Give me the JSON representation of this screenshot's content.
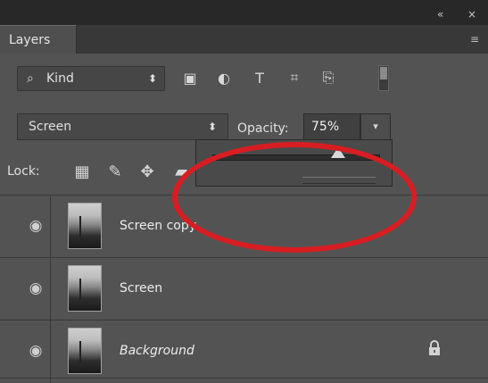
{
  "window": {
    "collapse_label": "«",
    "close_label": "×"
  },
  "panel": {
    "tab_label": "Layers",
    "menu_label": "≡"
  },
  "filter": {
    "kind_label": "Kind",
    "search_icon": "search-icon",
    "selector_arrows": "⬍",
    "icons": [
      "image-filter-icon",
      "adjustment-filter-icon",
      "type-filter-icon",
      "shape-filter-icon",
      "smart-object-filter-icon"
    ]
  },
  "blend": {
    "mode_label": "Screen",
    "arrows": "⬍"
  },
  "opacity": {
    "label": "Opacity:",
    "value": "75%",
    "slider_fraction": 0.75,
    "dropdown_icon": "chevron-down-icon"
  },
  "lock": {
    "label": "Lock:",
    "icons": [
      "lock-transparent-pixels-icon",
      "lock-image-pixels-icon",
      "lock-position-icon",
      "lock-all-icon"
    ]
  },
  "layers": [
    {
      "name": "Screen copy",
      "selected": true,
      "italic": false,
      "locked": false
    },
    {
      "name": "Screen",
      "selected": false,
      "italic": false,
      "locked": false
    },
    {
      "name": "Background",
      "selected": false,
      "italic": true,
      "locked": true
    }
  ],
  "colors": {
    "highlight": "#d81d22",
    "selected_row": "#5a7196",
    "panel_bg": "#535353"
  }
}
